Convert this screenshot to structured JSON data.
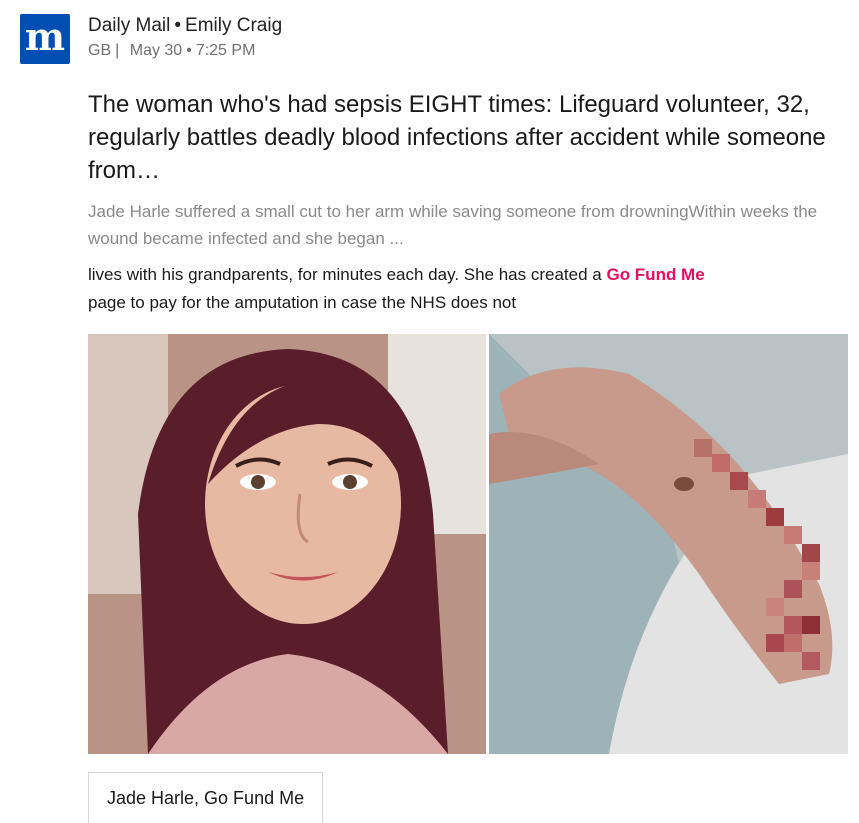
{
  "source": {
    "logo_letter": "m",
    "publisher": "Daily Mail",
    "separator": "•",
    "author": "Emily Craig",
    "region": "GB",
    "region_separator": "|",
    "date": "May 30",
    "time_separator": "•",
    "time": "7:25 PM",
    "brand_color": "#004db3"
  },
  "article": {
    "headline": "The woman who's had sepsis EIGHT times: Lifeguard volunteer, 32, regularly battles deadly blood infections after accident while someone from…",
    "summary": "Jade Harle suffered a small cut to her arm while saving someone from drowningWithin weeks the wound became infected and she began ...",
    "snippet_before": "lives with his grandparents, for minutes each day. She has created a ",
    "snippet_link": "Go Fund Me",
    "snippet_after": "page to pay for the amputation in case the NHS does not",
    "link_color": "#e0115f"
  },
  "media": {
    "caption": "Jade Harle, Go Fund Me"
  }
}
